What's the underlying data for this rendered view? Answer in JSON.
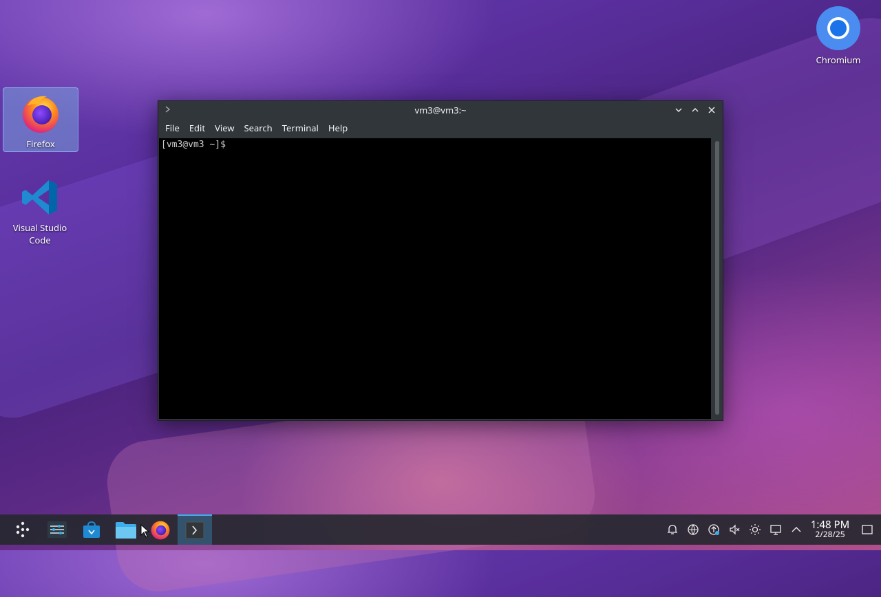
{
  "desktop": {
    "icons": [
      {
        "label": "Firefox",
        "icon": "firefox-icon"
      },
      {
        "label": "Visual Studio Code",
        "icon": "vscode-icon"
      },
      {
        "label": "Chromium",
        "icon": "chromium-icon"
      }
    ]
  },
  "terminal": {
    "title": "vm3@vm3:~",
    "menu": [
      "File",
      "Edit",
      "View",
      "Search",
      "Terminal",
      "Help"
    ],
    "prompt": "[vm3@vm3 ~]$"
  },
  "taskbar": {
    "items": [
      "app-launcher-icon",
      "system-settings-icon",
      "discover-store-icon",
      "file-manager-icon",
      "firefox-icon",
      "terminal-icon"
    ],
    "tray": [
      "notifications-icon",
      "network-icon",
      "updates-icon",
      "volume-muted-icon",
      "brightness-icon",
      "display-icon",
      "show-hidden-icon"
    ],
    "time": "1:48 PM",
    "date": "2/28/25"
  },
  "colors": {
    "accent": "#3daee9",
    "window_bg": "#31363b",
    "terminal_bg": "#000000"
  }
}
